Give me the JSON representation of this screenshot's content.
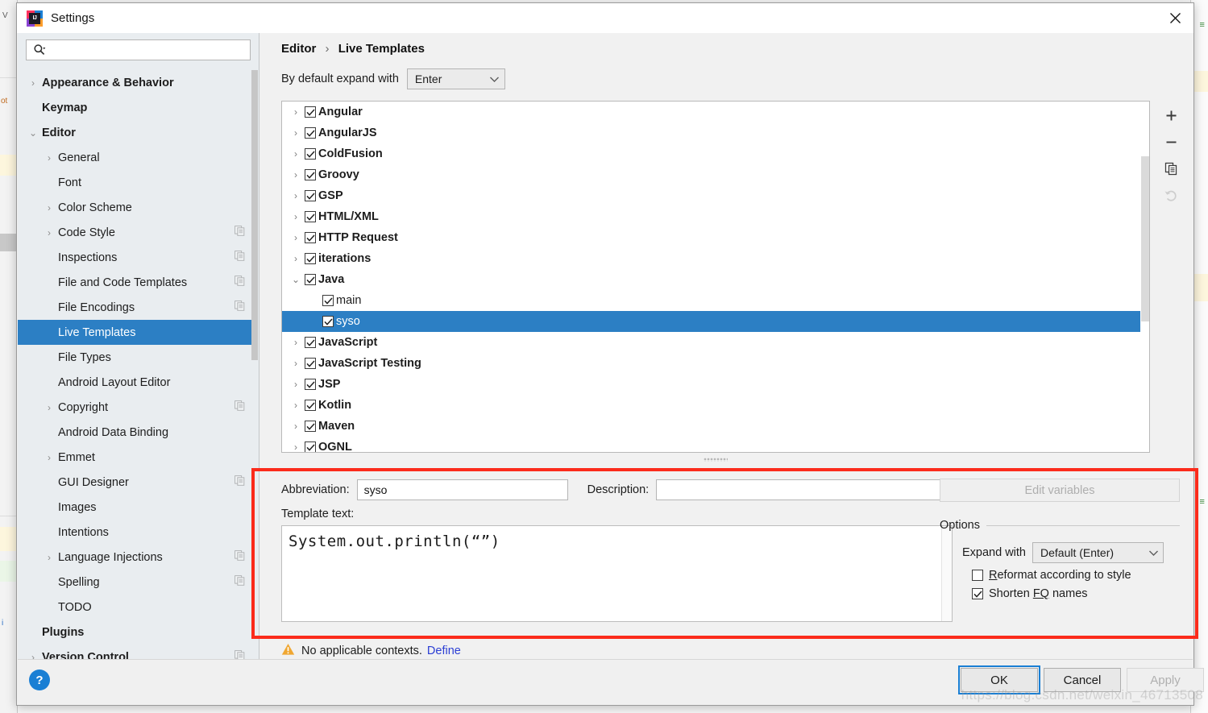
{
  "window": {
    "title": "Settings",
    "app_icon": "intellij-idea-icon",
    "close_icon": "close-icon"
  },
  "search": {
    "value": "",
    "placeholder": "",
    "icon": "search-icon"
  },
  "sidebar": {
    "items": [
      {
        "label": "Appearance & Behavior",
        "twisty": "›",
        "level": 0,
        "bold": true,
        "copy": false,
        "selected": false
      },
      {
        "label": "Keymap",
        "twisty": "",
        "level": 0,
        "bold": true,
        "copy": false,
        "selected": false
      },
      {
        "label": "Editor",
        "twisty": "⌄",
        "level": 0,
        "bold": true,
        "copy": false,
        "selected": false
      },
      {
        "label": "General",
        "twisty": "›",
        "level": 1,
        "bold": false,
        "copy": false,
        "selected": false
      },
      {
        "label": "Font",
        "twisty": "",
        "level": 1,
        "bold": false,
        "copy": false,
        "selected": false
      },
      {
        "label": "Color Scheme",
        "twisty": "›",
        "level": 1,
        "bold": false,
        "copy": false,
        "selected": false
      },
      {
        "label": "Code Style",
        "twisty": "›",
        "level": 1,
        "bold": false,
        "copy": true,
        "selected": false
      },
      {
        "label": "Inspections",
        "twisty": "",
        "level": 1,
        "bold": false,
        "copy": true,
        "selected": false
      },
      {
        "label": "File and Code Templates",
        "twisty": "",
        "level": 1,
        "bold": false,
        "copy": true,
        "selected": false
      },
      {
        "label": "File Encodings",
        "twisty": "",
        "level": 1,
        "bold": false,
        "copy": true,
        "selected": false
      },
      {
        "label": "Live Templates",
        "twisty": "",
        "level": 1,
        "bold": false,
        "copy": false,
        "selected": true
      },
      {
        "label": "File Types",
        "twisty": "",
        "level": 1,
        "bold": false,
        "copy": false,
        "selected": false
      },
      {
        "label": "Android Layout Editor",
        "twisty": "",
        "level": 1,
        "bold": false,
        "copy": false,
        "selected": false
      },
      {
        "label": "Copyright",
        "twisty": "›",
        "level": 1,
        "bold": false,
        "copy": true,
        "selected": false
      },
      {
        "label": "Android Data Binding",
        "twisty": "",
        "level": 1,
        "bold": false,
        "copy": false,
        "selected": false
      },
      {
        "label": "Emmet",
        "twisty": "›",
        "level": 1,
        "bold": false,
        "copy": false,
        "selected": false
      },
      {
        "label": "GUI Designer",
        "twisty": "",
        "level": 1,
        "bold": false,
        "copy": true,
        "selected": false
      },
      {
        "label": "Images",
        "twisty": "",
        "level": 1,
        "bold": false,
        "copy": false,
        "selected": false
      },
      {
        "label": "Intentions",
        "twisty": "",
        "level": 1,
        "bold": false,
        "copy": false,
        "selected": false
      },
      {
        "label": "Language Injections",
        "twisty": "›",
        "level": 1,
        "bold": false,
        "copy": true,
        "selected": false
      },
      {
        "label": "Spelling",
        "twisty": "",
        "level": 1,
        "bold": false,
        "copy": true,
        "selected": false
      },
      {
        "label": "TODO",
        "twisty": "",
        "level": 1,
        "bold": false,
        "copy": false,
        "selected": false
      },
      {
        "label": "Plugins",
        "twisty": "",
        "level": 0,
        "bold": true,
        "copy": false,
        "selected": false
      },
      {
        "label": "Version Control",
        "twisty": "›",
        "level": 0,
        "bold": true,
        "copy": true,
        "selected": false
      }
    ]
  },
  "content": {
    "breadcrumb": {
      "parent": "Editor",
      "separator": "›",
      "current": "Live Templates"
    },
    "default_expand": {
      "label": "By default expand with",
      "value": "Enter"
    },
    "tree": [
      {
        "label": "Angular",
        "twisty": "›",
        "level": 0,
        "checked": true,
        "selected": false
      },
      {
        "label": "AngularJS",
        "twisty": "›",
        "level": 0,
        "checked": true,
        "selected": false
      },
      {
        "label": "ColdFusion",
        "twisty": "›",
        "level": 0,
        "checked": true,
        "selected": false
      },
      {
        "label": "Groovy",
        "twisty": "›",
        "level": 0,
        "checked": true,
        "selected": false
      },
      {
        "label": "GSP",
        "twisty": "›",
        "level": 0,
        "checked": true,
        "selected": false
      },
      {
        "label": "HTML/XML",
        "twisty": "›",
        "level": 0,
        "checked": true,
        "selected": false
      },
      {
        "label": "HTTP Request",
        "twisty": "›",
        "level": 0,
        "checked": true,
        "selected": false
      },
      {
        "label": "iterations",
        "twisty": "›",
        "level": 0,
        "checked": true,
        "selected": false
      },
      {
        "label": "Java",
        "twisty": "⌄",
        "level": 0,
        "checked": true,
        "selected": false
      },
      {
        "label": "main",
        "twisty": "",
        "level": 1,
        "checked": true,
        "selected": false
      },
      {
        "label": "syso",
        "twisty": "",
        "level": 1,
        "checked": true,
        "selected": true
      },
      {
        "label": "JavaScript",
        "twisty": "›",
        "level": 0,
        "checked": true,
        "selected": false
      },
      {
        "label": "JavaScript Testing",
        "twisty": "›",
        "level": 0,
        "checked": true,
        "selected": false
      },
      {
        "label": "JSP",
        "twisty": "›",
        "level": 0,
        "checked": true,
        "selected": false
      },
      {
        "label": "Kotlin",
        "twisty": "›",
        "level": 0,
        "checked": true,
        "selected": false
      },
      {
        "label": "Maven",
        "twisty": "›",
        "level": 0,
        "checked": true,
        "selected": false
      },
      {
        "label": "OGNL",
        "twisty": "›",
        "level": 0,
        "checked": true,
        "selected": false
      }
    ],
    "tools": [
      {
        "name": "add-template-button",
        "glyph": "+",
        "enabled": true
      },
      {
        "name": "remove-template-button",
        "glyph": "−",
        "enabled": true
      },
      {
        "name": "duplicate-template-button",
        "glyph": "copy",
        "enabled": true
      },
      {
        "name": "revert-template-button",
        "glyph": "revert",
        "enabled": false
      }
    ]
  },
  "editor": {
    "abbreviation_label": "Abbreviation:",
    "abbreviation_value": "syso",
    "description_label": "Description:",
    "description_value": "",
    "template_text_label": "Template text:",
    "template_text_value": "System.out.println(“”)",
    "edit_variables_label": "Edit variables",
    "options_title": "Options",
    "expand_with_label": "Expand with",
    "expand_with_value": "Default (Enter)",
    "reformat_label": "Reformat according to style",
    "reformat_mnemonic": "R",
    "reformat_checked": false,
    "shorten_label": "Shorten FQ names",
    "shorten_mnemonic": "FQ",
    "shorten_checked": true
  },
  "status": {
    "warning_icon": "warning-triangle-icon",
    "warning_text": "No applicable contexts.",
    "define_link": "Define"
  },
  "footer": {
    "help_label": "?",
    "ok_label": "OK",
    "cancel_label": "Cancel",
    "apply_label": "Apply",
    "apply_enabled": false
  },
  "watermark": "https://blog.csdn.net/weixin_46713508",
  "colors": {
    "selection_blue": "#2c7fc4",
    "annotation_red": "#fb2b1b",
    "link_blue": "#2b3ed4",
    "warning_amber": "#f0a732",
    "help_blue": "#1a7fd4"
  }
}
